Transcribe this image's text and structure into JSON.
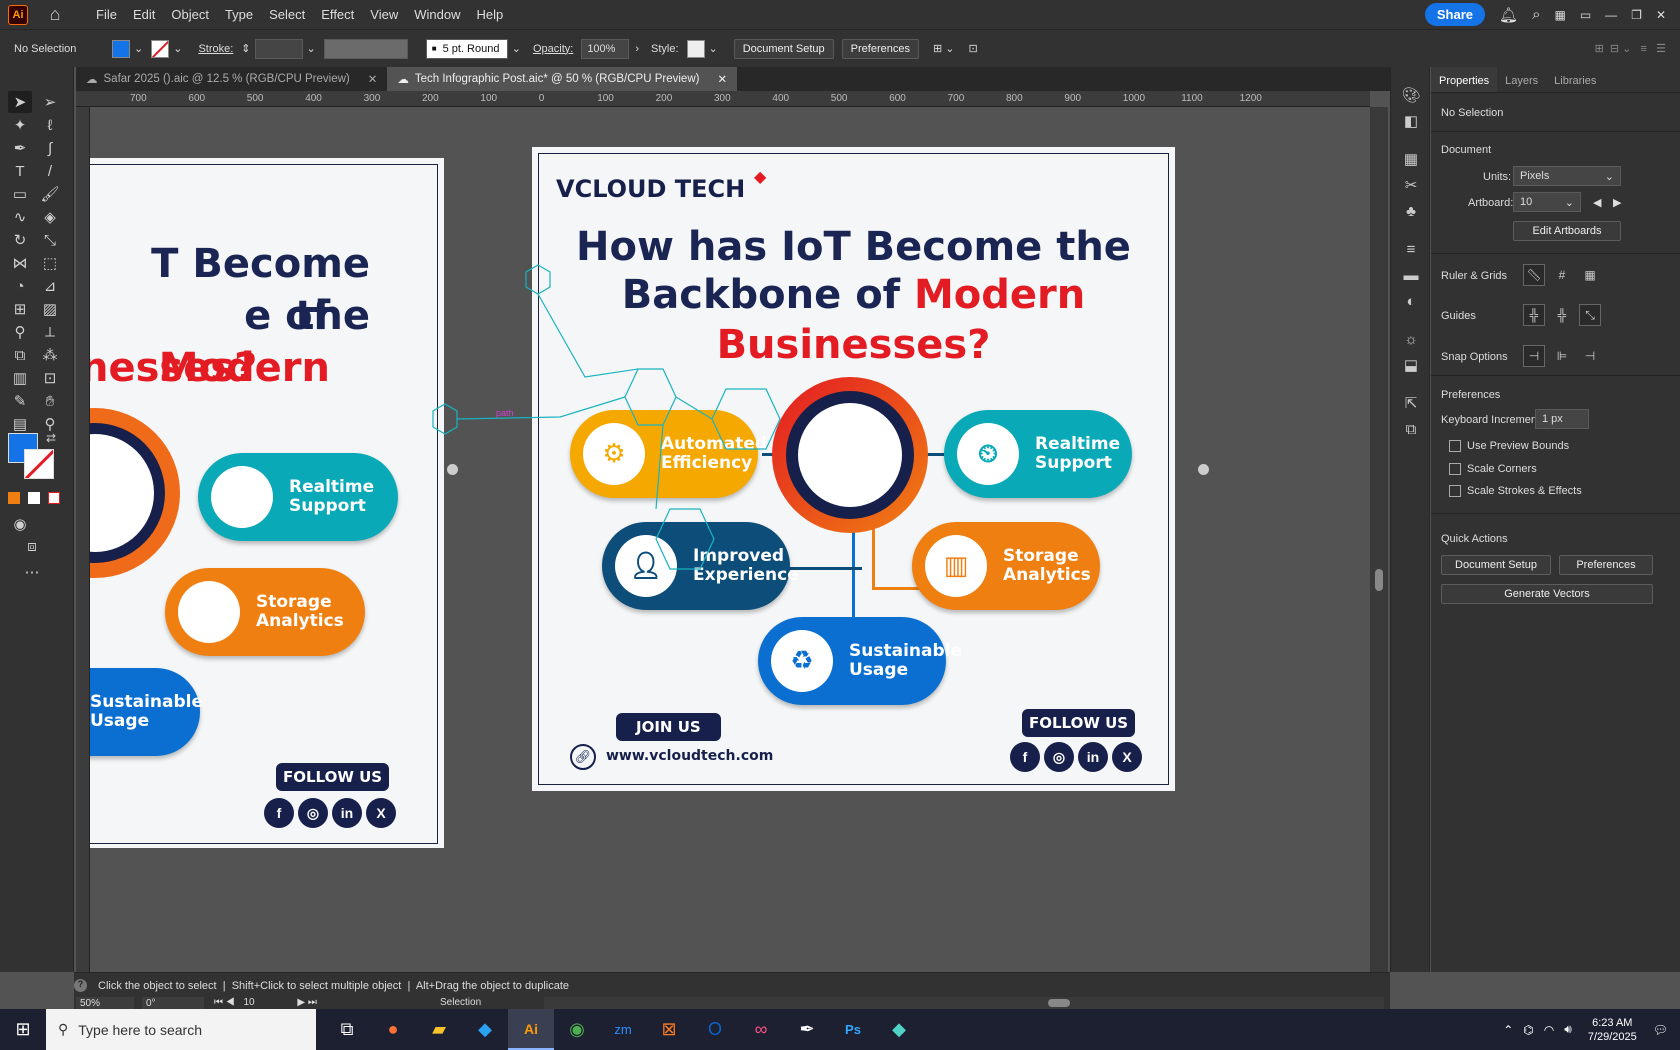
{
  "app": {
    "logo": "Ai"
  },
  "menu": {
    "items": [
      "File",
      "Edit",
      "Object",
      "Type",
      "Select",
      "Effect",
      "View",
      "Window",
      "Help"
    ],
    "share": "Share"
  },
  "control": {
    "selection": "No Selection",
    "stroke_label": "Stroke:",
    "brush": "5 pt. Round",
    "opacity_label": "Opacity:",
    "opacity": "100%",
    "style_label": "Style:",
    "document_setup": "Document Setup",
    "preferences": "Preferences"
  },
  "tabs": [
    {
      "label": "Safar 2025 ().aic @ 12.5 % (RGB/CPU Preview)"
    },
    {
      "label": "Tech Infographic Post.aic* @ 50 % (RGB/CPU Preview)"
    }
  ],
  "ruler": {
    "ticks": [
      "700",
      "600",
      "500",
      "400",
      "300",
      "200",
      "100",
      "0",
      "100",
      "200",
      "300",
      "400",
      "500",
      "600",
      "700",
      "800",
      "900",
      "1000",
      "1100",
      "1200"
    ]
  },
  "poster": {
    "brand": "VCLOUD TECH",
    "title_line1": "How has IoT Become the",
    "title_line2_a": "Backbone of ",
    "title_line2_b": "Modern",
    "title_line3": "Businesses?",
    "items": [
      {
        "label1": "Automated",
        "label2": "Efficiency",
        "color": "#f5a800"
      },
      {
        "label1": "Realtime",
        "label2": "Support",
        "color": "#0aa9b7"
      },
      {
        "label1": "Improved",
        "label2": "Experience",
        "color": "#0c4d7a"
      },
      {
        "label1": "Storage",
        "label2": "Analytics",
        "color": "#f07f12"
      },
      {
        "label1": "Sustainable",
        "label2": "Usage",
        "color": "#0b6fd1"
      }
    ],
    "join_us": "JOIN US",
    "follow_us": "FOLLOW US",
    "website": "www.vcloudtech.com",
    "path_label": "path"
  },
  "left_poster": {
    "title_line1": "T Become the",
    "title_line2_a": "e of ",
    "title_line2_b": "Modern",
    "title_line3": "nesses?",
    "sustainable_1": "Sustainable",
    "sustainable_2": "Usage"
  },
  "panel": {
    "tabs": [
      "Properties",
      "Layers",
      "Libraries"
    ],
    "no_selection": "No Selection",
    "document": "Document",
    "units_label": "Units:",
    "units": "Pixels",
    "artboard_label": "Artboard:",
    "artboard": "10",
    "edit_artboards": "Edit Artboards",
    "rulers_grids": "Ruler & Grids",
    "guides": "Guides",
    "snap_options": "Snap Options",
    "preferences": "Preferences",
    "keyboard_increment_label": "Keyboard Increment:",
    "keyboard_increment": "1 px",
    "use_preview_bounds": "Use Preview Bounds",
    "scale_corners": "Scale Corners",
    "scale_strokes": "Scale Strokes & Effects",
    "quick_actions": "Quick Actions",
    "document_setup": "Document Setup",
    "preferences_btn": "Preferences",
    "generate_vectors": "Generate Vectors"
  },
  "status": {
    "hint": "Click the object to select  |  Shift+Click to select multiple object  |  Alt+Drag the object to duplicate",
    "zoom": "50%",
    "rotation": "0°",
    "artboard": "10",
    "tool": "Selection"
  },
  "taskbar": {
    "search": "Type here to search",
    "time": "6:23 AM",
    "date": "7/29/2025"
  },
  "colors": {
    "accent": "#1473e6",
    "fill": "#1473e6"
  }
}
